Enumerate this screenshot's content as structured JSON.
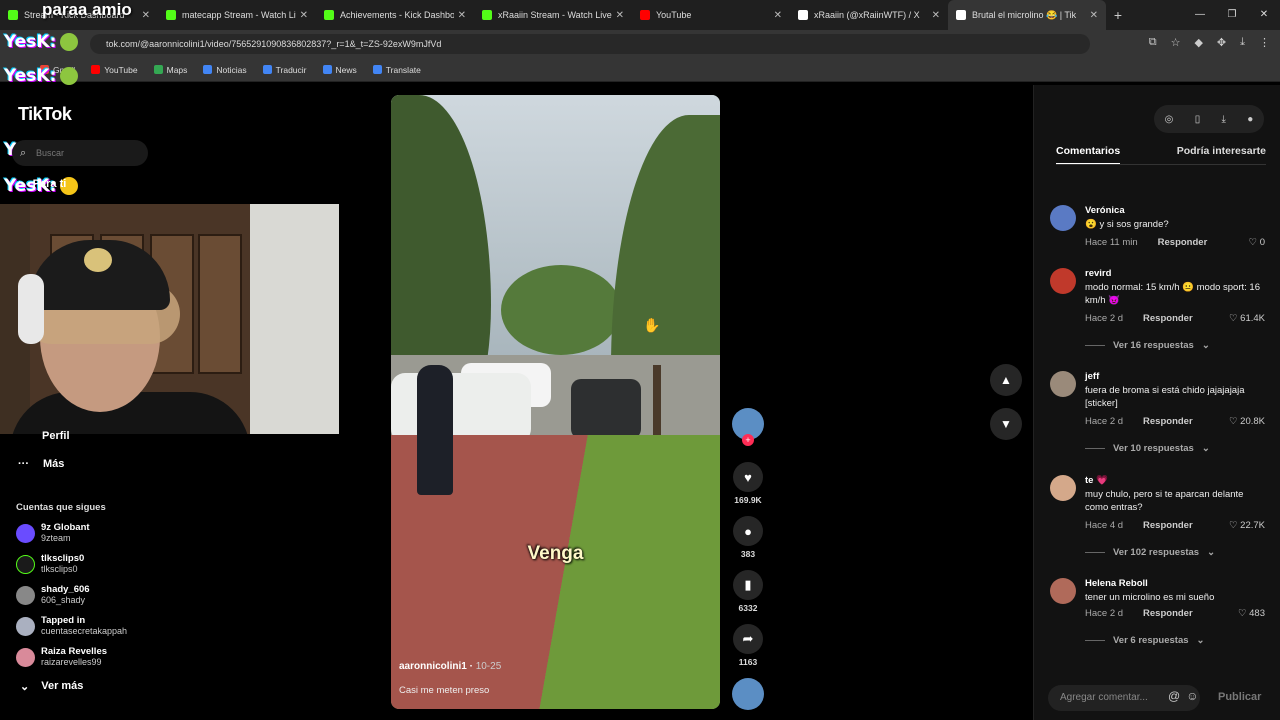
{
  "browser": {
    "tabs": [
      {
        "title": "Stream - Kick Dashboard",
        "color": "#53fc18"
      },
      {
        "title": "matecapp Stream - Watch Live",
        "color": "#53fc18"
      },
      {
        "title": "Achievements - Kick Dashboard",
        "color": "#53fc18"
      },
      {
        "title": "xRaaiin Stream - Watch Live on",
        "color": "#53fc18"
      },
      {
        "title": "YouTube",
        "color": "#ff0000"
      },
      {
        "title": "xRaaiin (@xRaiinWTF) / X",
        "color": "#ffffff"
      },
      {
        "title": "Brutal el microlino 😂 | Tik",
        "color": "#ffffff"
      }
    ],
    "url": "tok.com/@aaronnicolini1/video/7565291090836802837?_r=1&_t=ZS-92exW9mJfVd",
    "bookmarks": [
      "Gmail",
      "YouTube",
      "Maps",
      "Noticias",
      "Traducir",
      "News",
      "Translate"
    ]
  },
  "overlay": {
    "top_message": "paraa amio",
    "user": "YesK:",
    "lines": 5
  },
  "sidebar": {
    "logo": "TikTok",
    "search_placeholder": "Buscar",
    "home": "Para ti",
    "profile": "Perfil",
    "more": "Más",
    "following_title": "Cuentas que sigues",
    "following": [
      {
        "name": "9z Globant",
        "handle": "9zteam",
        "color": "#6a4cff"
      },
      {
        "name": "tlksclips0",
        "handle": "tlksclips0",
        "color": "#1a1a1a"
      },
      {
        "name": "shady_606",
        "handle": "606_shady",
        "color": "#888888"
      },
      {
        "name": "Tapped in",
        "handle": "cuentasecretakappah",
        "color": "#aab0c0"
      },
      {
        "name": "Raiza Revelles",
        "handle": "raizarevelles99",
        "color": "#d98a9a"
      }
    ],
    "see_more": "Ver más"
  },
  "video": {
    "caption_word": "Venga",
    "author": "aaronnicolini1",
    "date": "10-25",
    "description": "Casi me meten preso"
  },
  "actions": {
    "likes": "169.9K",
    "comments": "383",
    "saves": "6332",
    "shares": "1163"
  },
  "comments_panel": {
    "tab_comments": "Comentarios",
    "tab_interest": "Podría interesarte",
    "comments": [
      {
        "name": "Verónica",
        "text": "😮 y si sos grande?",
        "time": "Hace 11 min",
        "reply": "Responder",
        "likes": "0",
        "replies": "",
        "color": "#5a7ac4"
      },
      {
        "name": "revird",
        "text": "modo normal: 15 km/h 😐 modo sport: 16 km/h 😈",
        "time": "Hace 2 d",
        "reply": "Responder",
        "likes": "61.4K",
        "replies": "Ver 16 respuestas",
        "color": "#c0392b"
      },
      {
        "name": "jeff",
        "text": "fuera de broma si está chido jajajajaja [sticker]",
        "time": "Hace 2 d",
        "reply": "Responder",
        "likes": "20.8K",
        "replies": "Ver 10 respuestas",
        "color": "#9a8a7a"
      },
      {
        "name": "te 💗",
        "text": "muy chulo, pero si te aparcan delante como entras?",
        "time": "Hace 4 d",
        "reply": "Responder",
        "likes": "22.7K",
        "replies": "Ver 102 respuestas",
        "color": "#d4a88a"
      },
      {
        "name": "Helena Reboll",
        "text": "tener un microlino es mi sueño",
        "time": "Hace 2 d",
        "reply": "Responder",
        "likes": "483",
        "replies": "Ver 6 respuestas",
        "color": "#b06a5a"
      }
    ],
    "input_placeholder": "Agregar comentar...",
    "publish": "Publicar"
  }
}
